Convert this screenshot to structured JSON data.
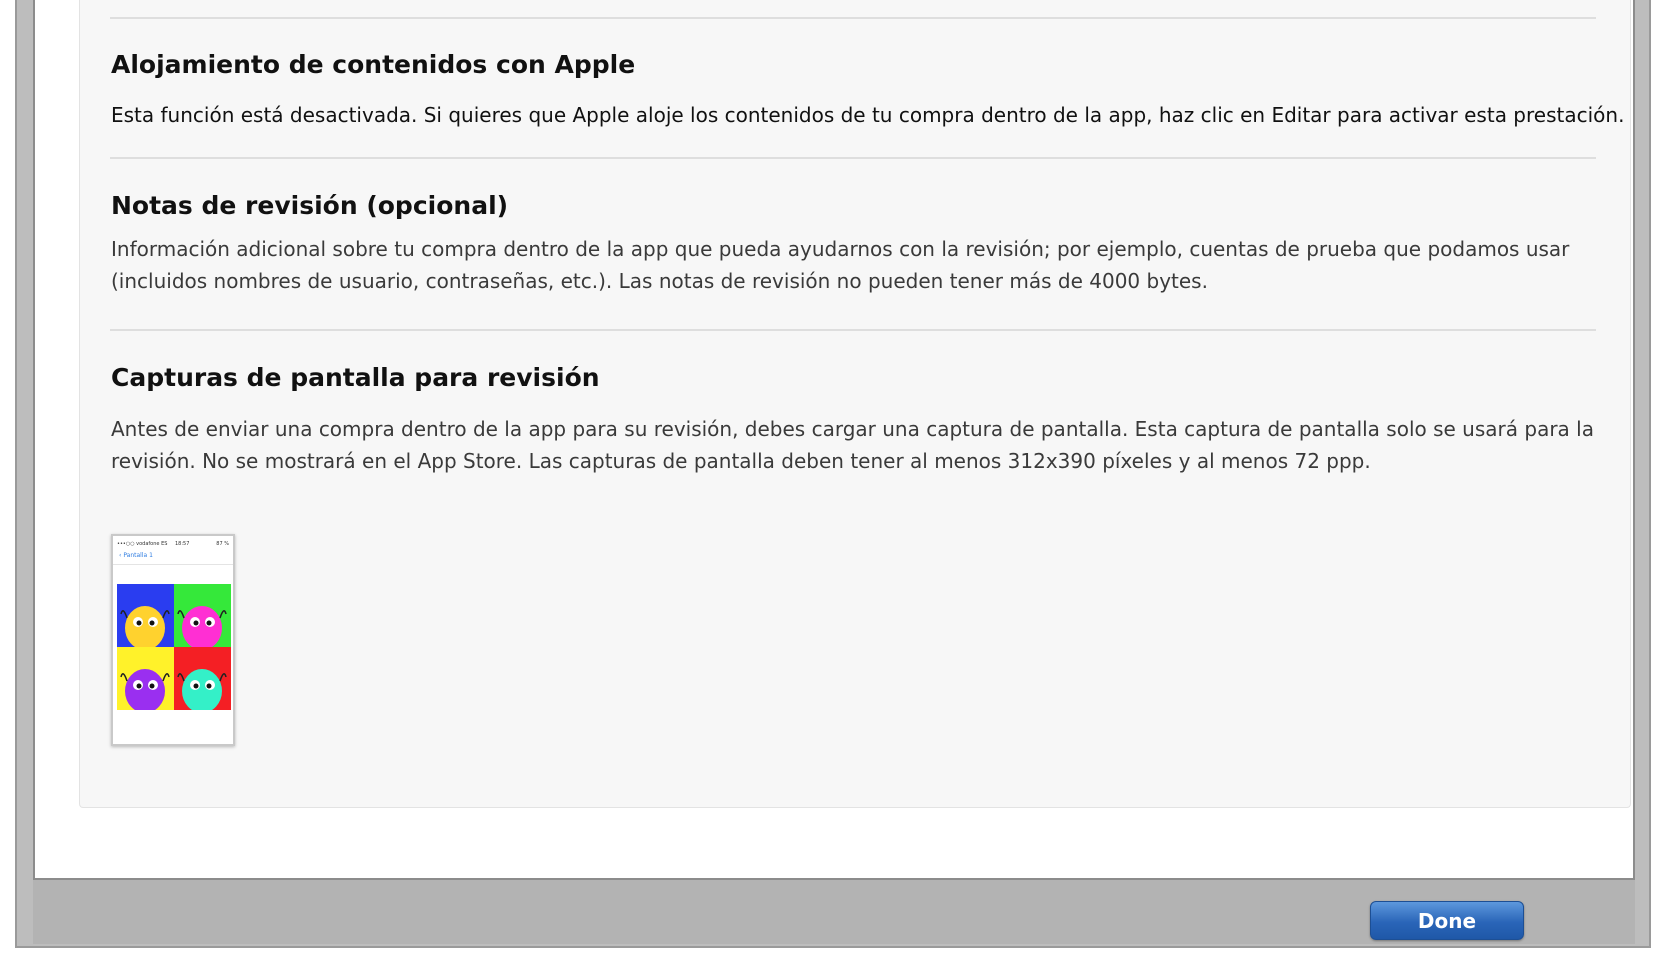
{
  "sections": {
    "hosting": {
      "title": "Alojamiento de contenidos con Apple",
      "text": "Esta función está desactivada. Si quieres que Apple aloje los contenidos de tu compra dentro de la app, haz clic en Editar para activar esta prestación."
    },
    "review_notes": {
      "title": "Notas de revisión (opcional)",
      "line1": "Información adicional sobre tu compra dentro de la app que pueda ayudarnos con la revisión; por ejemplo, cuentas de prueba que podamos usar",
      "line2": "(incluidos nombres de usuario, contraseñas, etc.). Las notas de revisión no pueden tener más de 4000 bytes."
    },
    "review_screenshot": {
      "title": "Capturas de pantalla para revisión",
      "line1": "Antes de enviar una compra dentro de la app para su revisión, debes cargar una captura de pantalla. Esta captura de pantalla solo se usará para la",
      "line2": "revisión. No se mostrará en el App Store. Las capturas de pantalla deben tener al menos 312x390 píxeles y al menos 72 ppp."
    }
  },
  "thumbnail": {
    "status_left": "•••○○ vodafone ES",
    "status_time": "18:57",
    "status_right": "87 %",
    "nav_back": "Pantalla 1",
    "cells": [
      {
        "bg": "#2a3df0",
        "character": "#ffd22e"
      },
      {
        "bg": "#35e83a",
        "character": "#ff2fd3"
      },
      {
        "bg": "#fff22a",
        "character": "#9a2ff0"
      },
      {
        "bg": "#f41f24",
        "character": "#34f0c8"
      }
    ]
  },
  "footer": {
    "done_label": "Done"
  },
  "colors": {
    "accent": "#2a65b8",
    "panel_bg": "#f7f7f7",
    "divider": "#dedede"
  }
}
